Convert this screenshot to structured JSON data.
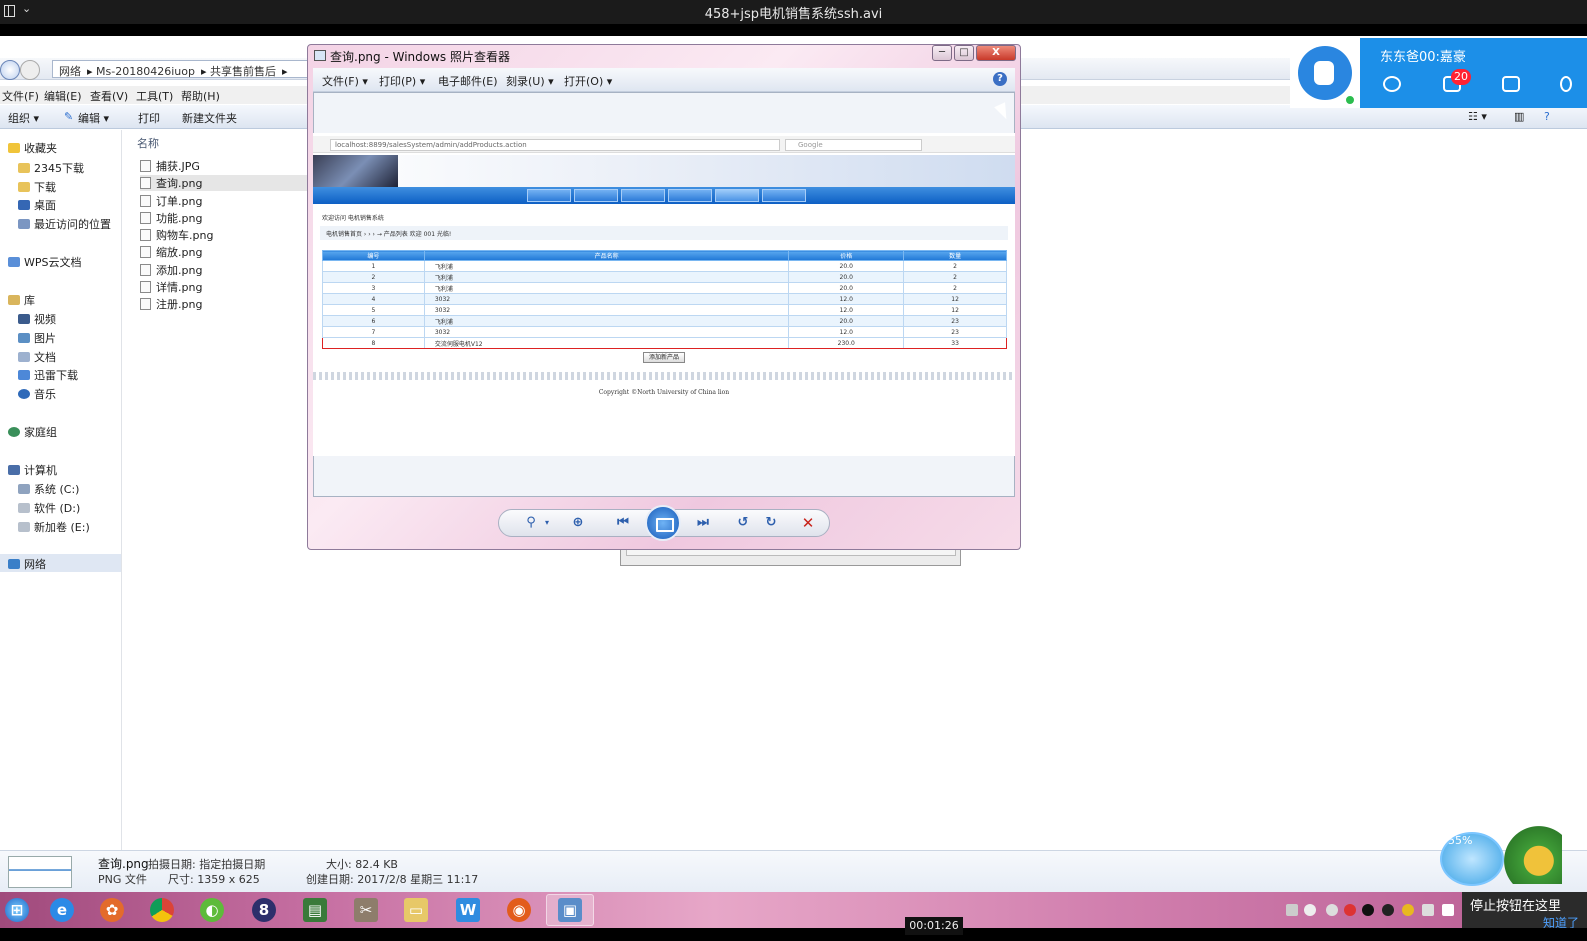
{
  "player": {
    "title": "458+jsp电机销售系统ssh.avi",
    "timecode": "00:01:26"
  },
  "explorer": {
    "breadcrumb": [
      "网络",
      "Ms-20180426iuop",
      "共享售前售后"
    ],
    "menu": [
      "文件(F)",
      "编辑(E)",
      "查看(V)",
      "工具(T)",
      "帮助(H)"
    ],
    "commands": {
      "organize": "组织 ▾",
      "edit": "编辑 ▾",
      "print": "打印",
      "new_folder": "新建文件夹"
    },
    "column_name": "名称",
    "nav": {
      "favorites": "收藏夹",
      "fav_items": [
        "2345下载",
        "下载",
        "桌面",
        "最近访问的位置"
      ],
      "wps": "WPS云文档",
      "libraries": "库",
      "lib_items": [
        "视频",
        "图片",
        "文档",
        "迅雷下载",
        "音乐"
      ],
      "homegroup": "家庭组",
      "computer": "计算机",
      "drives": [
        "系统 (C:)",
        "软件 (D:)",
        "新加卷 (E:)"
      ],
      "network": "网络"
    },
    "files": [
      "捕获.JPG",
      "查询.png",
      "订单.png",
      "功能.png",
      "购物车.png",
      "缩放.png",
      "添加.png",
      "详情.png",
      "注册.png"
    ],
    "selected_file": "查询.png",
    "details": {
      "name": "查询.png",
      "taken_label": "拍摄日期: 指定拍摄日期",
      "type": "PNG 文件",
      "dims_label": "尺寸: 1359 x 625",
      "size_label": "大小: 82.4 KB",
      "created_label": "创建日期: 2017/2/8 星期三 11:17"
    }
  },
  "qq": {
    "name": "东东爸00:嘉豪",
    "mail_count": "20"
  },
  "fish": {
    "percent": "55%"
  },
  "viewer": {
    "title": "查询.png - Windows 照片查看器",
    "menu": [
      "文件(F) ▾",
      "打印(P) ▾",
      "电子邮件(E)",
      "刻录(U) ▾",
      "打开(O) ▾"
    ],
    "help": "?",
    "window_buttons": {
      "min": "─",
      "max": "□",
      "close": "X"
    }
  },
  "webpage": {
    "url": "localhost:8899/salesSystem/admin/addProducts.action",
    "search_placeholder": "Google",
    "welcome": "欢迎访问 电机销售系统",
    "crumb": "电机销售首页 › › › → 产品列表  欢迎 001 光临!",
    "columns": [
      "编号",
      "产品名称",
      "价格",
      "数量"
    ],
    "rows": [
      [
        "1",
        "飞利浦",
        "20.0",
        "2"
      ],
      [
        "2",
        "飞利浦",
        "20.0",
        "2"
      ],
      [
        "3",
        "飞利浦",
        "20.0",
        "2"
      ],
      [
        "4",
        "3032",
        "12.0",
        "12"
      ],
      [
        "5",
        "3032",
        "12.0",
        "12"
      ],
      [
        "6",
        "飞利浦",
        "20.0",
        "23"
      ],
      [
        "7",
        "3032",
        "12.0",
        "23"
      ],
      [
        "8",
        "交流伺服电机V12",
        "230.0",
        "33"
      ]
    ],
    "add_button": "添加新产品",
    "copyright": "Copyright ©North University of China lion"
  },
  "tray": {
    "stop_note": "停止按钮在这里",
    "got_it": "知道了"
  }
}
